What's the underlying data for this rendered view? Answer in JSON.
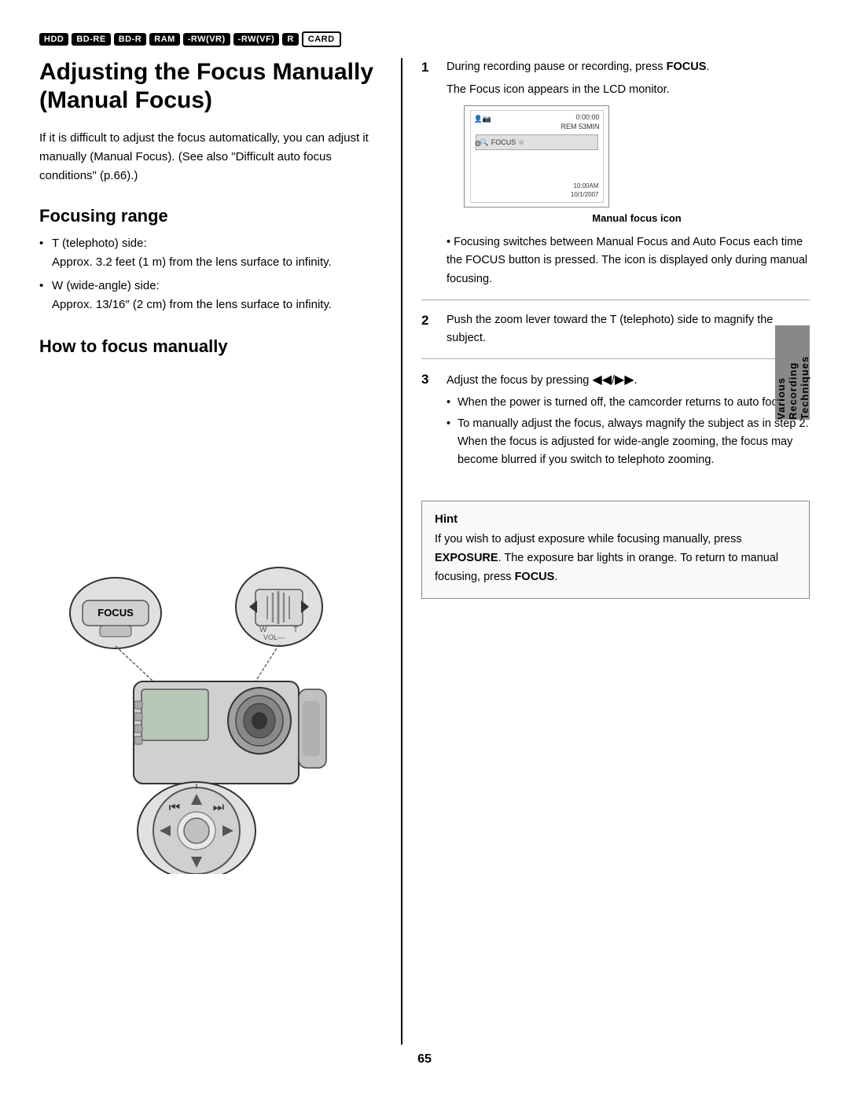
{
  "badges": [
    {
      "label": "HDD",
      "type": "filled"
    },
    {
      "label": "BD-RE",
      "type": "filled"
    },
    {
      "label": "BD-R",
      "type": "filled"
    },
    {
      "label": "RAM",
      "type": "filled"
    },
    {
      "label": "-RW(VR)",
      "type": "filled"
    },
    {
      "label": "-RW(VF)",
      "type": "filled"
    },
    {
      "label": "R",
      "type": "filled"
    },
    {
      "label": "CARD",
      "type": "outline"
    }
  ],
  "page_title": "Adjusting the Focus Manually (Manual Focus)",
  "body_text": "If it is difficult to adjust the focus automatically, you can adjust it manually (Manual Focus). (See also \"Difficult auto focus conditions\" (p.66).)",
  "focusing_range_heading": "Focusing range",
  "focusing_range_bullets": [
    "T (telephoto) side:\nApprox. 3.2 feet (1 m) from the lens surface to infinity.",
    "W (wide-angle) side:\nApprox. 13/16″ (2 cm) from the lens surface to infinity."
  ],
  "how_to_focus_heading": "How to focus manually",
  "step1": {
    "num": "1",
    "intro": "During recording pause or recording, press ",
    "intro_bold": "FOCUS",
    "intro2": ".",
    "sub1": "The Focus icon appears in the LCD monitor.",
    "lcd_caption": "Manual focus icon",
    "bullet": "Focusing switches between Manual Focus and Auto Focus each time the FOCUS button is pressed. The icon is displayed only during manual focusing."
  },
  "step2": {
    "num": "2",
    "text": "Push the zoom lever toward the T (telephoto) side to magnify the subject."
  },
  "step3": {
    "num": "3",
    "intro": "Adjust the focus by pressing ",
    "arrows": "◀◀/ ▶▶",
    "bullet1": "When the power is turned off, the camcorder returns to auto focus.",
    "bullet2": "To manually adjust the focus, always magnify the subject as in step 2. When the focus is adjusted for wide-angle zooming, the focus may become blurred if you switch to telephoto zooming."
  },
  "hint": {
    "title": "Hint",
    "text1": "If you wish to adjust exposure while focusing manually, press ",
    "text1_bold": "EXPOSURE",
    "text2": ". The exposure bar lights in orange. To return to manual focusing, press ",
    "text2_bold": "FOCUS",
    "text3": "."
  },
  "side_label": "Various Recording Techniques",
  "page_number": "65",
  "lcd": {
    "time_code": "0:00:00",
    "rem": "REM 53MIN",
    "date": "10/1/2007",
    "clock": "10:00AM"
  }
}
